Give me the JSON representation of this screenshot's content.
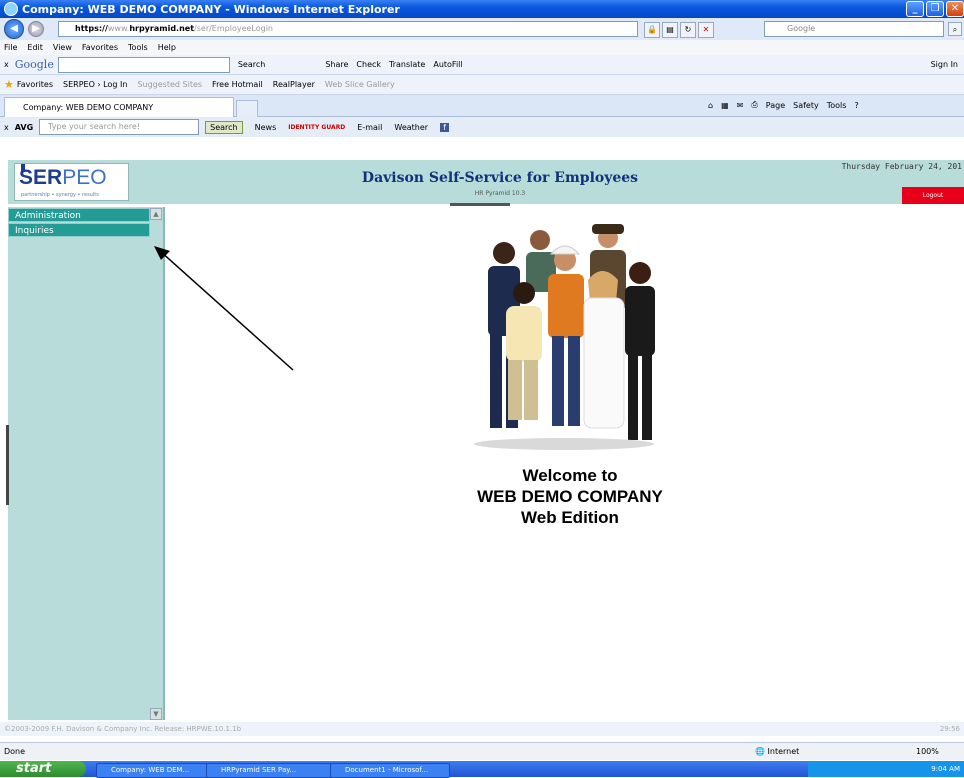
{
  "browser": {
    "window_title": "Company: WEB DEMO COMPANY - Windows Internet Explorer",
    "address_https": "https://",
    "address_host": "www.",
    "address_domain": "hrpyramid.net",
    "address_path": "/ser/EmployeeLogin",
    "search_placeholder": "Google",
    "menu": [
      "File",
      "Edit",
      "View",
      "Favorites",
      "Tools",
      "Help"
    ],
    "google_label": "Google",
    "google_items": [
      "Search",
      "Share",
      "Check",
      "Translate",
      "AutoFill"
    ],
    "google_signin": "Sign In",
    "favorites": {
      "label": "Favorites",
      "items": [
        "SERPEO › Log In",
        "Suggested Sites",
        "Free Hotmail",
        "RealPlayer",
        "Web Slice Gallery"
      ]
    },
    "tab_title": "Company: WEB DEMO COMPANY",
    "command_items": [
      "Page",
      "Safety",
      "Tools"
    ],
    "avg_label": "AVG",
    "avg_placeholder": "Type your search here!",
    "avg_search": "Search",
    "avg_items": [
      "News",
      "IDENTITY GUARD",
      "E-mail",
      "Weather"
    ]
  },
  "app": {
    "logo_ser": "SER",
    "logo_peo": "PEO",
    "logo_tagline": "partnership • synergy • results",
    "title": "Davison Self-Service for Employees",
    "version": "HR Pyramid 10.3",
    "date": "Thursday February 24, 201",
    "logout": "Logout",
    "nav": [
      "Administration",
      "Inquiries"
    ],
    "welcome_line1": "Welcome to",
    "welcome_line2": "WEB DEMO COMPANY",
    "welcome_line3": "Web Edition",
    "footer_copyright": "©2003-2009 F.H. Davison & Company Inc.  Release: HRPWE.10.1.1b",
    "footer_time": "29:56"
  },
  "status": {
    "left": "Done",
    "zone": "Internet",
    "zoom": "100%"
  },
  "taskbar": {
    "start": "start",
    "tasks": [
      "Company: WEB DEM...",
      "HRPyramid SER  Pay...",
      "Document1 - Microsof..."
    ],
    "clock": "9:04 AM"
  }
}
